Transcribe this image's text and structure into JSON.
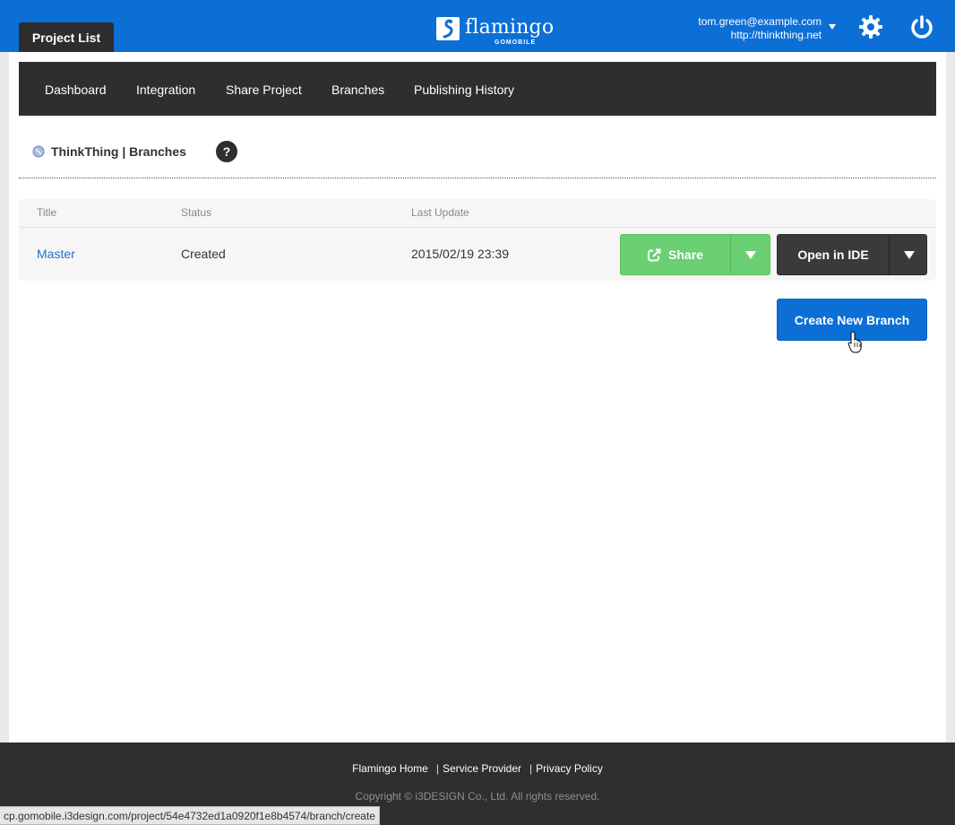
{
  "header": {
    "tab_label": "Project List",
    "logo_text": "flamingo",
    "logo_sub": "GOMOBILE",
    "account_email": "tom.green@example.com",
    "account_url": "http://thinkthing.net"
  },
  "subnav": {
    "items": [
      {
        "label": "Dashboard"
      },
      {
        "label": "Integration"
      },
      {
        "label": "Share Project"
      },
      {
        "label": "Branches"
      },
      {
        "label": "Publishing History"
      }
    ]
  },
  "breadcrumb": {
    "text": "ThinkThing | Branches",
    "help": "?"
  },
  "table": {
    "headers": {
      "title": "Title",
      "status": "Status",
      "last_update": "Last Update"
    },
    "rows": [
      {
        "title": "Master",
        "status": "Created",
        "last_update": "2015/02/19 23:39"
      }
    ]
  },
  "actions": {
    "share_label": "Share",
    "open_ide_label": "Open in IDE",
    "create_branch_label": "Create New Branch"
  },
  "footer": {
    "links": [
      "Flamingo Home",
      "Service Provider",
      "Privacy Policy"
    ],
    "copyright": "Copyright © i3DESIGN Co., Ltd. All rights reserved."
  },
  "statusbar": {
    "url": "cp.gomobile.i3design.com/project/54e4732ed1a0920f1e8b4574/branch/create"
  },
  "colors": {
    "brand_blue": "#0b6fd6",
    "share_green": "#6bcf73",
    "dark": "#2e2e2e"
  }
}
